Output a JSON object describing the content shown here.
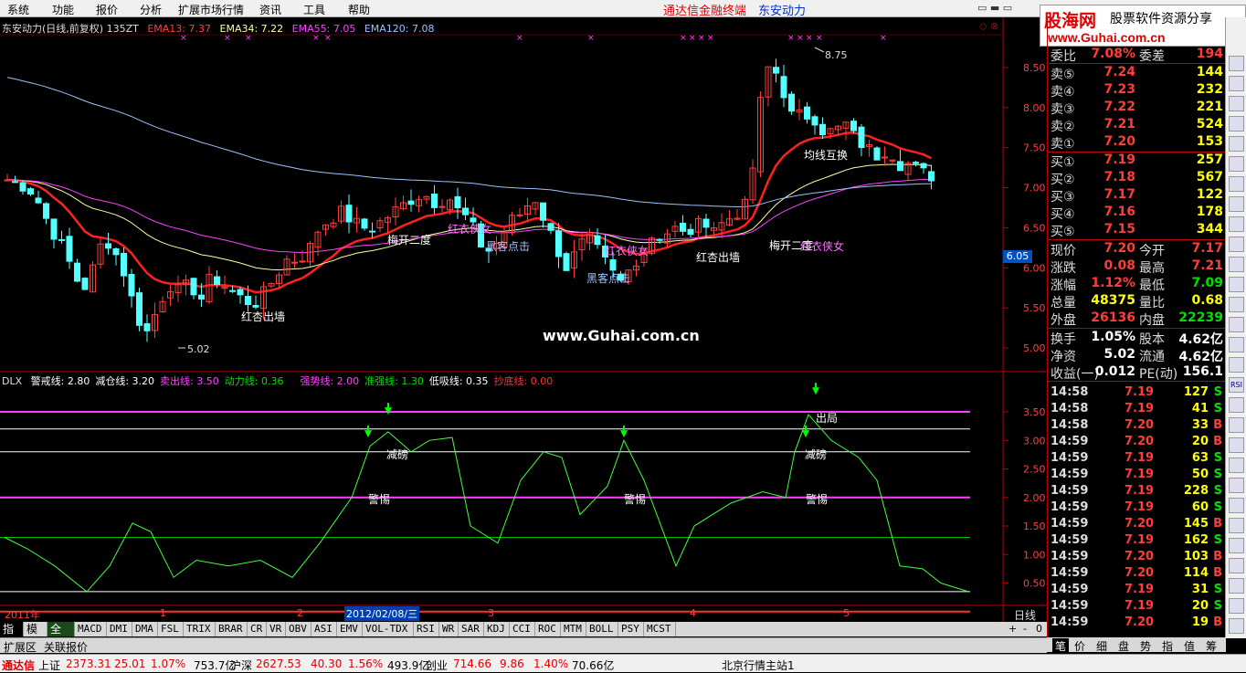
{
  "menu": [
    "系统",
    "功能",
    "报价",
    "分析",
    "扩展市场行情",
    "资讯",
    "工具",
    "帮助"
  ],
  "app_title": "通达信金融终端",
  "stock_name": "东安动力",
  "logo": {
    "main": "股海网",
    "sub": "股票软件资源分享",
    "url": "www.Guhai.com.cn"
  },
  "header_line": {
    "left": "东安动力(日线,前复权) 135ZT",
    "ema13": "EMA13: 7.37",
    "ema34": "EMA34: 7.22",
    "ema55": "EMA55: 7.05",
    "ema120": "EMA120: 7.08"
  },
  "indicator_line": {
    "name": "DLX",
    "items": [
      {
        "t": "警戒线: 2.80",
        "c": "#ffffff"
      },
      {
        "t": "减仓线: 3.20",
        "c": "#ffffff"
      },
      {
        "t": "卖出线: 3.50",
        "c": "#ff40ff"
      },
      {
        "t": "动力线: 0.36",
        "c": "#00e000"
      },
      {
        "t": "强势线: 2.00",
        "c": "#ff40ff"
      },
      {
        "t": "准强线: 1.30",
        "c": "#00e000"
      },
      {
        "t": "低吸线: 0.35",
        "c": "#ffffff"
      },
      {
        "t": "抄底线: 0.00",
        "c": "#ff3030"
      }
    ]
  },
  "price_axis": [
    "8.50",
    "8.00",
    "7.50",
    "7.00",
    "6.50",
    "6.00",
    "5.50",
    "5.00"
  ],
  "ind_axis": [
    "3.50",
    "3.00",
    "2.50",
    "2.00",
    "1.50",
    "1.00",
    "0.50"
  ],
  "price_box": "6.05",
  "high_label": "8.75",
  "low_label": "5.02",
  "watermark": "www.Guhai.com.cn",
  "annotations": [
    {
      "t": "红杏出墙",
      "c": "#ffffff"
    },
    {
      "t": "梅开二度",
      "c": "#ffffff"
    },
    {
      "t": "红衣侠女",
      "c": "#ff70ff"
    },
    {
      "t": "黑客点击",
      "c": "#a0c0ff"
    },
    {
      "t": "红衣侠女",
      "c": "#ff70ff"
    },
    {
      "t": "黑客点击",
      "c": "#a0c0ff"
    },
    {
      "t": "红杏出墙",
      "c": "#ffffff"
    },
    {
      "t": "梅开二度",
      "c": "#ffffff"
    },
    {
      "t": "红衣侠女",
      "c": "#ff70ff"
    },
    {
      "t": "均线互换",
      "c": "#ffffff"
    }
  ],
  "ind_annotations": [
    "减磅",
    "警惕",
    "警惕",
    "出局",
    "减磅",
    "警惕"
  ],
  "time_axis": [
    "2011年",
    "1",
    "2",
    "2012/02/08/三",
    "3",
    "4",
    "5"
  ],
  "period": "日线",
  "quote": {
    "top": {
      "lab": "委比",
      "v1": "7.08%",
      "l2": "委差",
      "v2": "194"
    },
    "sell": [
      {
        "lab": "卖⑤",
        "p": "7.24",
        "v": "144"
      },
      {
        "lab": "卖④",
        "p": "7.23",
        "v": "232"
      },
      {
        "lab": "卖③",
        "p": "7.22",
        "v": "221"
      },
      {
        "lab": "卖②",
        "p": "7.21",
        "v": "524"
      },
      {
        "lab": "卖①",
        "p": "7.20",
        "v": "153"
      }
    ],
    "buy": [
      {
        "lab": "买①",
        "p": "7.19",
        "v": "257"
      },
      {
        "lab": "买②",
        "p": "7.18",
        "v": "567"
      },
      {
        "lab": "买③",
        "p": "7.17",
        "v": "122"
      },
      {
        "lab": "买④",
        "p": "7.16",
        "v": "178"
      },
      {
        "lab": "买⑤",
        "p": "7.15",
        "v": "344"
      }
    ],
    "stats": [
      {
        "lab": "现价",
        "v1": "7.20",
        "c1": "#ff3c3c",
        "l2": "今开",
        "v2": "7.17",
        "c2": "#ff3c3c"
      },
      {
        "lab": "涨跌",
        "v1": "0.08",
        "c1": "#ff3c3c",
        "l2": "最高",
        "v2": "7.21",
        "c2": "#ff3c3c"
      },
      {
        "lab": "涨幅",
        "v1": "1.12%",
        "c1": "#ff3c3c",
        "l2": "最低",
        "v2": "7.09",
        "c2": "#00e000"
      },
      {
        "lab": "总量",
        "v1": "48375",
        "c1": "#ffff00",
        "l2": "量比",
        "v2": "0.68",
        "c2": "#ffff00"
      },
      {
        "lab": "外盘",
        "v1": "26136",
        "c1": "#ff3c3c",
        "l2": "内盘",
        "v2": "22239",
        "c2": "#00e000"
      }
    ],
    "fin": [
      {
        "lab": "换手",
        "v1": "1.05%",
        "l2": "股本",
        "v2": "4.62亿"
      },
      {
        "lab": "净资",
        "v1": "5.02",
        "l2": "流通",
        "v2": "4.62亿"
      },
      {
        "lab": "收益(一)",
        "v1": "0.012",
        "l2": "PE(动)",
        "v2": "156.1"
      }
    ]
  },
  "ticks": [
    {
      "t": "14:58",
      "p": "7.19",
      "v": "127",
      "bs": "S"
    },
    {
      "t": "14:58",
      "p": "7.19",
      "v": "41",
      "bs": "S"
    },
    {
      "t": "14:58",
      "p": "7.20",
      "v": "33",
      "bs": "B"
    },
    {
      "t": "14:59",
      "p": "7.20",
      "v": "20",
      "bs": "B"
    },
    {
      "t": "14:59",
      "p": "7.19",
      "v": "63",
      "bs": "S"
    },
    {
      "t": "14:59",
      "p": "7.19",
      "v": "50",
      "bs": "S"
    },
    {
      "t": "14:59",
      "p": "7.19",
      "v": "228",
      "bs": "S"
    },
    {
      "t": "14:59",
      "p": "7.19",
      "v": "60",
      "bs": "S"
    },
    {
      "t": "14:59",
      "p": "7.20",
      "v": "145",
      "bs": "B"
    },
    {
      "t": "14:59",
      "p": "7.19",
      "v": "162",
      "bs": "S"
    },
    {
      "t": "14:59",
      "p": "7.20",
      "v": "103",
      "bs": "B"
    },
    {
      "t": "14:59",
      "p": "7.20",
      "v": "114",
      "bs": "B"
    },
    {
      "t": "14:59",
      "p": "7.19",
      "v": "31",
      "bs": "S"
    },
    {
      "t": "14:59",
      "p": "7.19",
      "v": "20",
      "bs": "S"
    },
    {
      "t": "14:59",
      "p": "7.20",
      "v": "19",
      "bs": "B"
    }
  ],
  "tabs": [
    "指标",
    "模板",
    "全部",
    "MACD",
    "DMI",
    "DMA",
    "FSL",
    "TRIX",
    "BRAR",
    "CR",
    "VR",
    "OBV",
    "ASI",
    "EMV",
    "VOL-TDX",
    "RSI",
    "WR",
    "SAR",
    "KDJ",
    "CCI",
    "ROC",
    "MTM",
    "BOLL",
    "PSY",
    "MCST"
  ],
  "tabs2": [
    "扩展区",
    "关联报价"
  ],
  "rtabs": [
    "笔",
    "价",
    "细",
    "盘",
    "势",
    "指",
    "值",
    "筹"
  ],
  "ctrl": [
    "+",
    "-",
    "0"
  ],
  "status": [
    {
      "t": "通达信",
      "c": "#e00000"
    },
    {
      "t": "上证",
      "c": "#000"
    },
    {
      "t": "2373.31",
      "c": "#e00000"
    },
    {
      "t": "25.01",
      "c": "#e00000"
    },
    {
      "t": "1.07%",
      "c": "#e00000"
    },
    {
      "t": "753.7亿",
      "c": "#000"
    },
    {
      "t": "沪深",
      "c": "#000"
    },
    {
      "t": "2627.53",
      "c": "#e00000"
    },
    {
      "t": "40.30",
      "c": "#e00000"
    },
    {
      "t": "1.56%",
      "c": "#e00000"
    },
    {
      "t": "493.9亿",
      "c": "#000"
    },
    {
      "t": "创业",
      "c": "#000"
    },
    {
      "t": "714.66",
      "c": "#e00000"
    },
    {
      "t": "9.86",
      "c": "#e00000"
    },
    {
      "t": "1.40%",
      "c": "#e00000"
    },
    {
      "t": "70.66亿",
      "c": "#000"
    },
    {
      "t": "北京行情主站1",
      "c": "#000"
    }
  ],
  "tool_icons": [
    "1",
    "2",
    "3",
    "4",
    "5",
    "6",
    "7",
    "8",
    "9",
    "10",
    "11",
    "12",
    "13",
    "14",
    "15",
    "16",
    "RSI",
    "17",
    "18",
    "19",
    "20",
    "21",
    "22",
    "23",
    "24",
    "25",
    "26",
    "27",
    "28"
  ]
}
